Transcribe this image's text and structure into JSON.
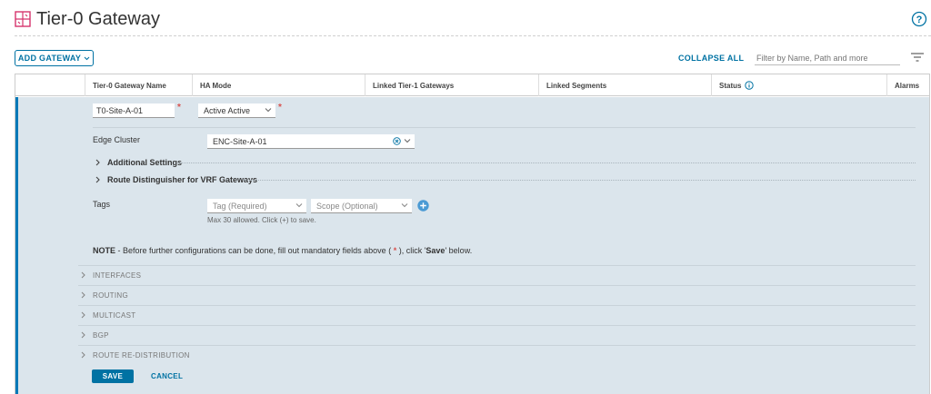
{
  "header": {
    "title": "Tier-0 Gateway",
    "icon": "tier0-gateway-icon",
    "help_icon": "help-icon"
  },
  "toolbar": {
    "add_gateway_label": "ADD GATEWAY",
    "collapse_all_label": "COLLAPSE ALL",
    "filter_placeholder": "Filter by Name, Path and more",
    "filter_icon": "filter-icon"
  },
  "table": {
    "columns": [
      "Tier-0 Gateway Name",
      "HA Mode",
      "Linked Tier-1 Gateways",
      "Linked Segments",
      "Status",
      "Alarms"
    ],
    "status_info_icon": "info-icon"
  },
  "form": {
    "name_value": "T0-Site-A-01",
    "ha_mode_value": "Active Active",
    "required_mark": "*",
    "edge_cluster_label": "Edge Cluster",
    "edge_cluster_value": "ENC-Site-A-01",
    "additional_settings_label": "Additional Settings",
    "route_distinguisher_label": "Route Distinguisher for VRF Gateways",
    "tags_label": "Tags",
    "tag_placeholder": "Tag (Required)",
    "scope_placeholder": "Scope (Optional)",
    "tags_hint": "Max 30 allowed. Click (+) to save.",
    "note_prefix": "NOTE",
    "note_text_1": " - Before further configurations can be done, fill out mandatory fields above ( ",
    "note_asterisk": "*",
    "note_text_2": " ), click '",
    "note_save": "Save",
    "note_text_3": "' below.",
    "sections": [
      "INTERFACES",
      "ROUTING",
      "MULTICAST",
      "BGP",
      "ROUTE RE-DISTRIBUTION"
    ],
    "save_label": "SAVE",
    "cancel_label": "CANCEL"
  },
  "colors": {
    "accent": "#0072a3",
    "row_bg": "#dbe5ec",
    "required": "#d9534f",
    "icon_pink": "#d6336c"
  }
}
